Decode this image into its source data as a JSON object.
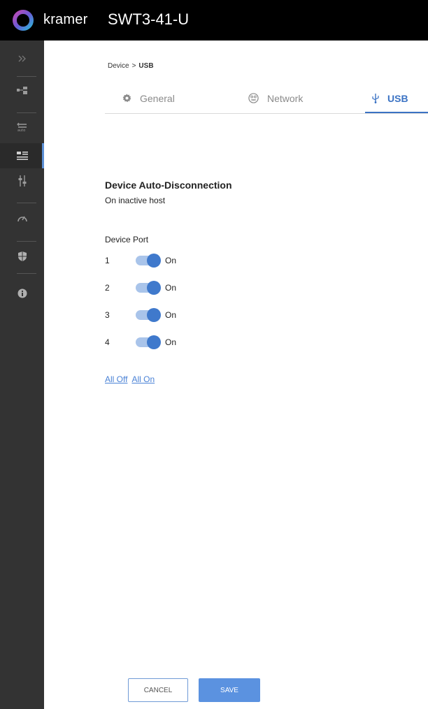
{
  "header": {
    "brand": "kramer",
    "device_name": "SWT3-41-U"
  },
  "breadcrumb": {
    "root": "Device",
    "separator": ">",
    "current": "USB"
  },
  "tabs": [
    {
      "label": "General",
      "icon": "gear-icon"
    },
    {
      "label": "Network",
      "icon": "network-icon"
    },
    {
      "label": "USB",
      "icon": "usb-icon",
      "active": true
    }
  ],
  "section": {
    "title": "Device Auto-Disconnection",
    "subtitle": "On inactive host",
    "port_heading": "Device Port"
  },
  "ports": [
    {
      "number": "1",
      "state": "On"
    },
    {
      "number": "2",
      "state": "On"
    },
    {
      "number": "3",
      "state": "On"
    },
    {
      "number": "4",
      "state": "On"
    }
  ],
  "links": {
    "all_off": "All Off",
    "all_on": "All On"
  },
  "buttons": {
    "cancel": "CANCEL",
    "save": "SAVE"
  },
  "colors": {
    "accent": "#3b73c4",
    "toggle_on": "#3f79cc",
    "sidebar_bg": "#333333",
    "topbar_bg": "#000000"
  },
  "sidebar_icons": [
    "expand-icon",
    "routing-icon",
    "auto-switch-icon",
    "device-settings-icon",
    "audio-icon",
    "diagnostics-icon",
    "security-icon",
    "info-icon"
  ]
}
